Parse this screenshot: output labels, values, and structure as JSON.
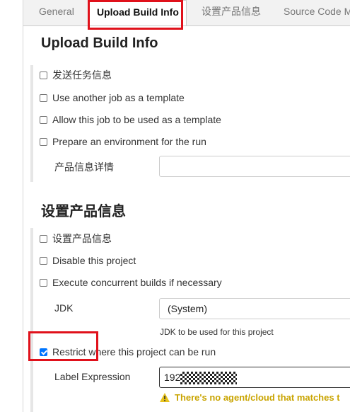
{
  "tabs": [
    {
      "label": "General"
    },
    {
      "label": "Upload Build Info"
    },
    {
      "label": "设置产品信息"
    },
    {
      "label": "Source Code M"
    }
  ],
  "section1": {
    "title": "Upload Build Info",
    "options": [
      {
        "label": "发送任务信息",
        "checked": false
      },
      {
        "label": "Use another job as a template",
        "checked": false
      },
      {
        "label": "Allow this job to be used as a template",
        "checked": false
      },
      {
        "label": "Prepare an environment for the run",
        "checked": false
      }
    ],
    "detail_label": "产品信息详情",
    "detail_value": ""
  },
  "section2": {
    "title": "设置产品信息",
    "options": [
      {
        "label": "设置产品信息",
        "checked": false
      },
      {
        "label": "Disable this project",
        "checked": false
      },
      {
        "label": "Execute concurrent builds if necessary",
        "checked": false
      }
    ],
    "jdk_label": "JDK",
    "jdk_value": "(System)",
    "jdk_help": "JDK to be used for this project",
    "restrict_label": "Restrict where this project can be run",
    "restrict_checked": true,
    "label_expression_label": "Label Expression",
    "label_expression_value": "192",
    "warning_text": "There's no agent/cloud that matches t"
  },
  "colors": {
    "highlight": "#e0111b",
    "warning": "#c9a400",
    "checkbox_checked": "#0075ff"
  }
}
